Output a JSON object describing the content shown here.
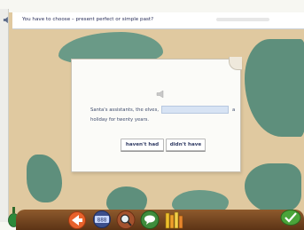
{
  "instruction": {
    "text": "You have to choose – present perfect or simple past?"
  },
  "question": {
    "before_gap": "Santa's assistants, the elves,",
    "after_gap": "a",
    "line2": "holiday for twenty years.",
    "answer_value": ""
  },
  "choices": [
    {
      "label": "haven't had"
    },
    {
      "label": "didn't have"
    }
  ],
  "toolbar": {
    "icons": [
      "bottle-icon",
      "arrow-icon",
      "timer-display-icon",
      "magnifier-icon",
      "chat-bubble-icon",
      "bookshelf-icon",
      "check-icon"
    ]
  },
  "colors": {
    "map_sea": "#5e8f7c",
    "map_land": "#e0c9a0",
    "answer_slot": "#d7e3f4",
    "toolbar": "#8e5a2c",
    "text": "#3d4a6b"
  }
}
